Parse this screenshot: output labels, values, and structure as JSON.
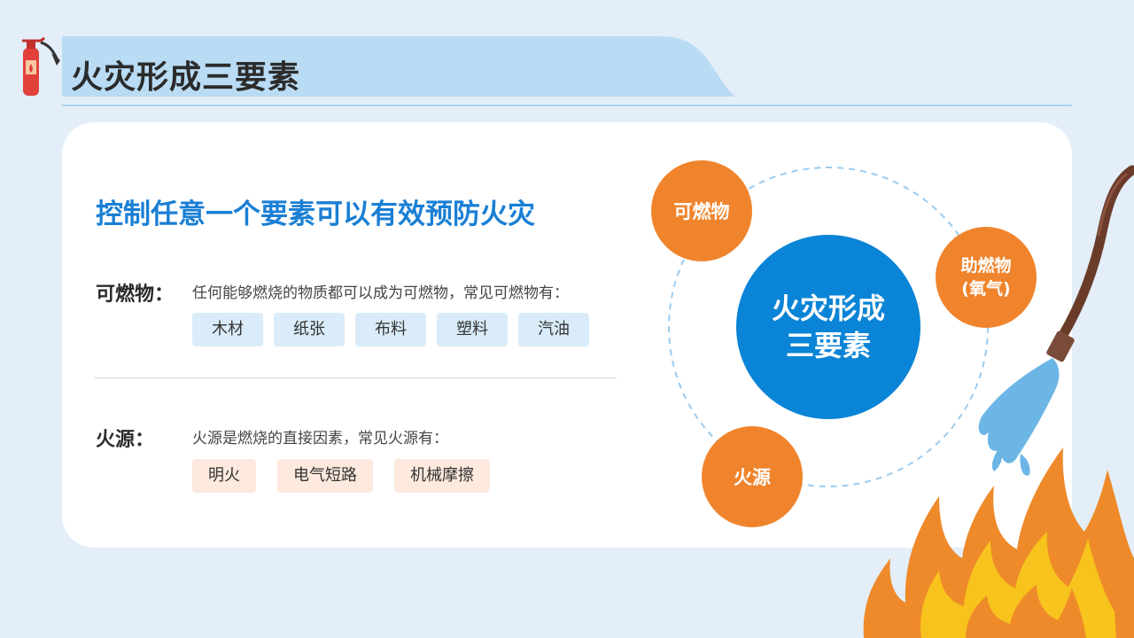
{
  "header": {
    "title": "火灾形成三要素"
  },
  "content": {
    "headline": "控制任意一个要素可以有效预防火灾",
    "sections": [
      {
        "label": "可燃物：",
        "desc": "任何能够燃烧的物质都可以成为可燃物，常见可燃物有：",
        "tags": [
          "木材",
          "纸张",
          "布料",
          "塑料",
          "汽油"
        ]
      },
      {
        "label": "火源：",
        "desc": "火源是燃烧的直接因素，常见火源有：",
        "tags": [
          "明火",
          "电气短路",
          "机械摩擦"
        ]
      }
    ]
  },
  "diagram": {
    "center": [
      "火灾形成",
      "三要素"
    ],
    "nodes": [
      {
        "label": "可燃物"
      },
      {
        "label": "助燃物",
        "sub": "(氧气)"
      },
      {
        "label": "火源"
      }
    ]
  },
  "colors": {
    "accent_blue": "#0a84d6",
    "headline_blue": "#1a7fd4",
    "orange": "#f0842c",
    "background": "#e3eef9"
  },
  "icons": {
    "title_icon": "fire-extinguisher-icon",
    "decor": [
      "water-hose-icon",
      "flame-icon"
    ]
  }
}
